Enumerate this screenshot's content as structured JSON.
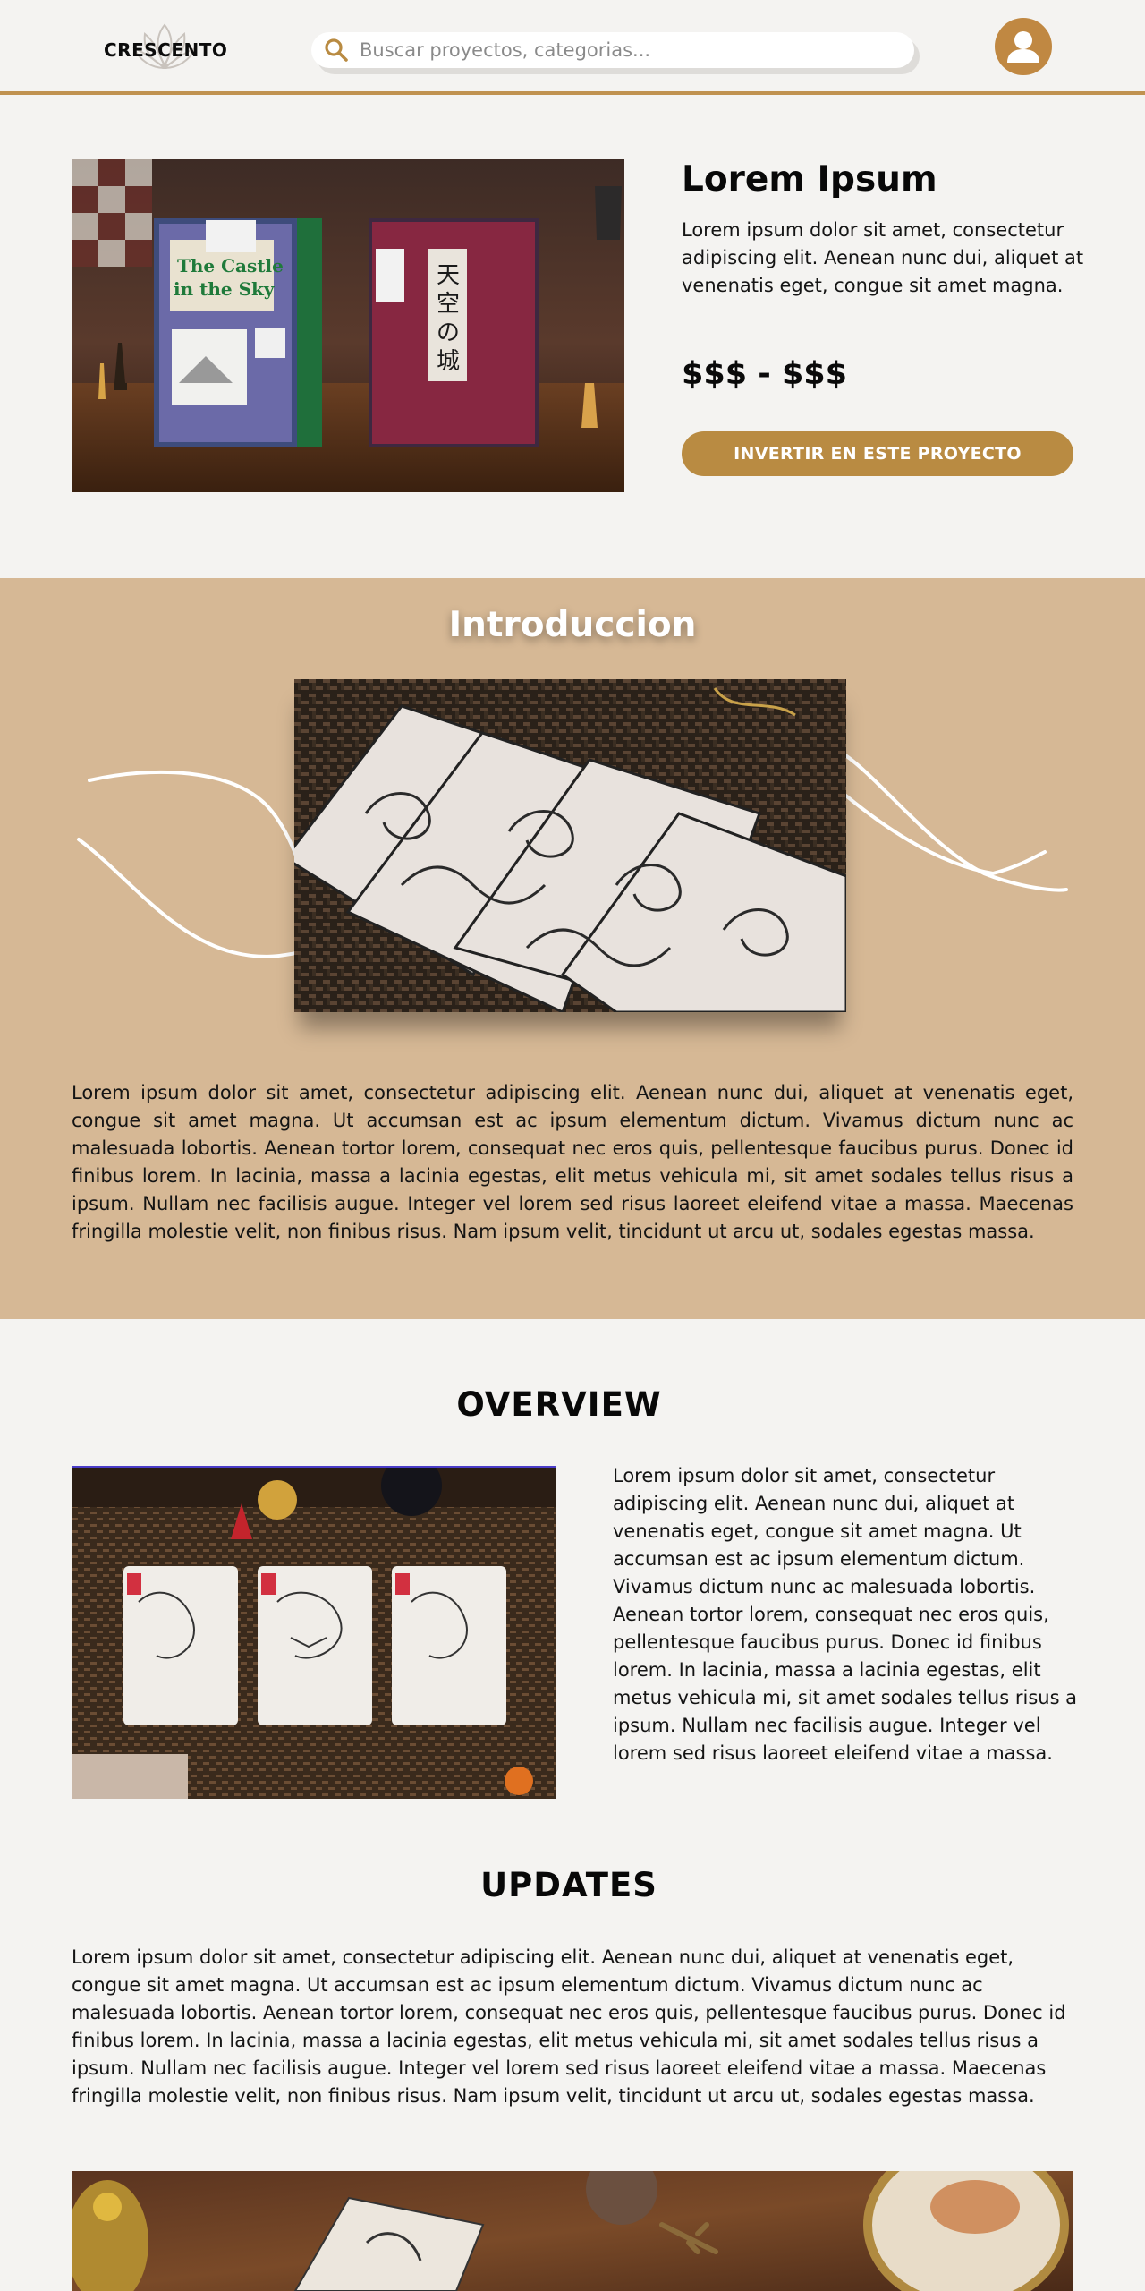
{
  "brand": {
    "name": "CRESCENTO",
    "accent": "#c09250",
    "button_color": "#b98b42",
    "section_bg": "#d6b895"
  },
  "search": {
    "placeholder": "Buscar proyectos, categorias..."
  },
  "hero": {
    "title": "Lorem Ipsum",
    "description": "Lorem ipsum dolor sit amet, consectetur adipiscing elit. Aenean nunc dui, aliquet at venenatis eget, congue sit amet magna.",
    "price": "$$$ - $$$",
    "cta_label": "INVERTIR EN ESTE PROYECTO",
    "image_text": {
      "left_box": "The Castle in the Sky",
      "right_box": "天空の城"
    }
  },
  "intro": {
    "title": "Introduccion",
    "body": "Lorem ipsum dolor sit amet, consectetur adipiscing elit. Aenean nunc dui, aliquet at venenatis eget, congue sit amet magna. Ut accumsan est ac ipsum elementum dictum. Vivamus dictum nunc ac malesuada lobortis. Aenean tortor lorem, consequat nec eros quis, pellentesque faucibus purus. Donec id finibus lorem. In lacinia, massa a lacinia egestas, elit metus vehicula mi, sit amet sodales tellus risus a ipsum. Nullam nec facilisis augue. Integer vel lorem sed risus laoreet eleifend vitae a massa. Maecenas fringilla molestie velit, non finibus risus. Nam ipsum velit, tincidunt ut arcu ut, sodales egestas massa."
  },
  "overview": {
    "title": "OVERVIEW",
    "body": "Lorem ipsum dolor sit amet, consectetur adipiscing elit. Aenean nunc dui, aliquet at venenatis eget, congue sit amet magna. Ut accumsan est ac ipsum elementum dictum. Vivamus dictum nunc ac malesuada lobortis. Aenean tortor lorem, consequat nec eros quis, pellentesque faucibus purus. Donec id finibus lorem. In lacinia, massa a lacinia egestas, elit metus vehicula mi, sit amet sodales tellus risus a ipsum. Nullam nec facilisis augue. Integer vel lorem sed risus laoreet eleifend vitae a massa."
  },
  "updates": {
    "title": "UPDATES",
    "body": "Lorem ipsum dolor sit amet, consectetur adipiscing elit. Aenean nunc dui, aliquet at venenatis eget, congue sit amet magna. Ut accumsan est ac ipsum elementum dictum. Vivamus dictum nunc ac malesuada lobortis. Aenean tortor lorem, consequat nec eros quis, pellentesque faucibus purus. Donec id finibus lorem. In lacinia, massa a lacinia egestas, elit metus vehicula mi, sit amet sodales tellus risus a ipsum. Nullam nec facilisis augue. Integer vel lorem sed risus laoreet eleifend vitae a massa. Maecenas fringilla molestie velit, non finibus risus. Nam ipsum velit, tincidunt ut arcu ut, sodales egestas massa."
  },
  "icons": [
    "lotus-logo-icon",
    "search-icon",
    "user-avatar-icon"
  ]
}
